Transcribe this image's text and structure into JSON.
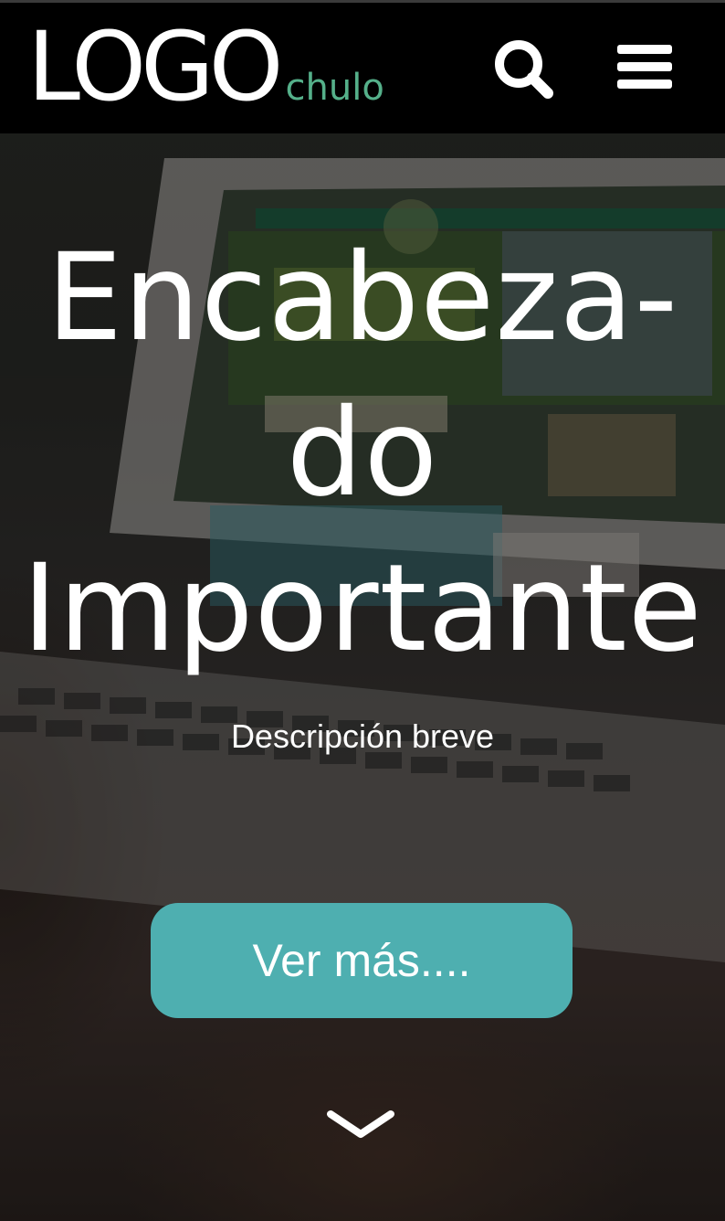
{
  "header": {
    "logo_main": "LOGO",
    "logo_sub": "chulo",
    "icons": {
      "search": "search-icon",
      "menu": "hamburger-menu-icon"
    }
  },
  "hero": {
    "title_lines": [
      "Encabeza-",
      "do",
      "Importante"
    ],
    "description": "Descripción breve",
    "cta_label": "Ver más....",
    "scroll_icon": "chevron-down-icon"
  },
  "colors": {
    "header_bg": "#000000",
    "logo_sub": "#55b08a",
    "cta_bg": "#4eafb0",
    "text": "#ffffff"
  }
}
